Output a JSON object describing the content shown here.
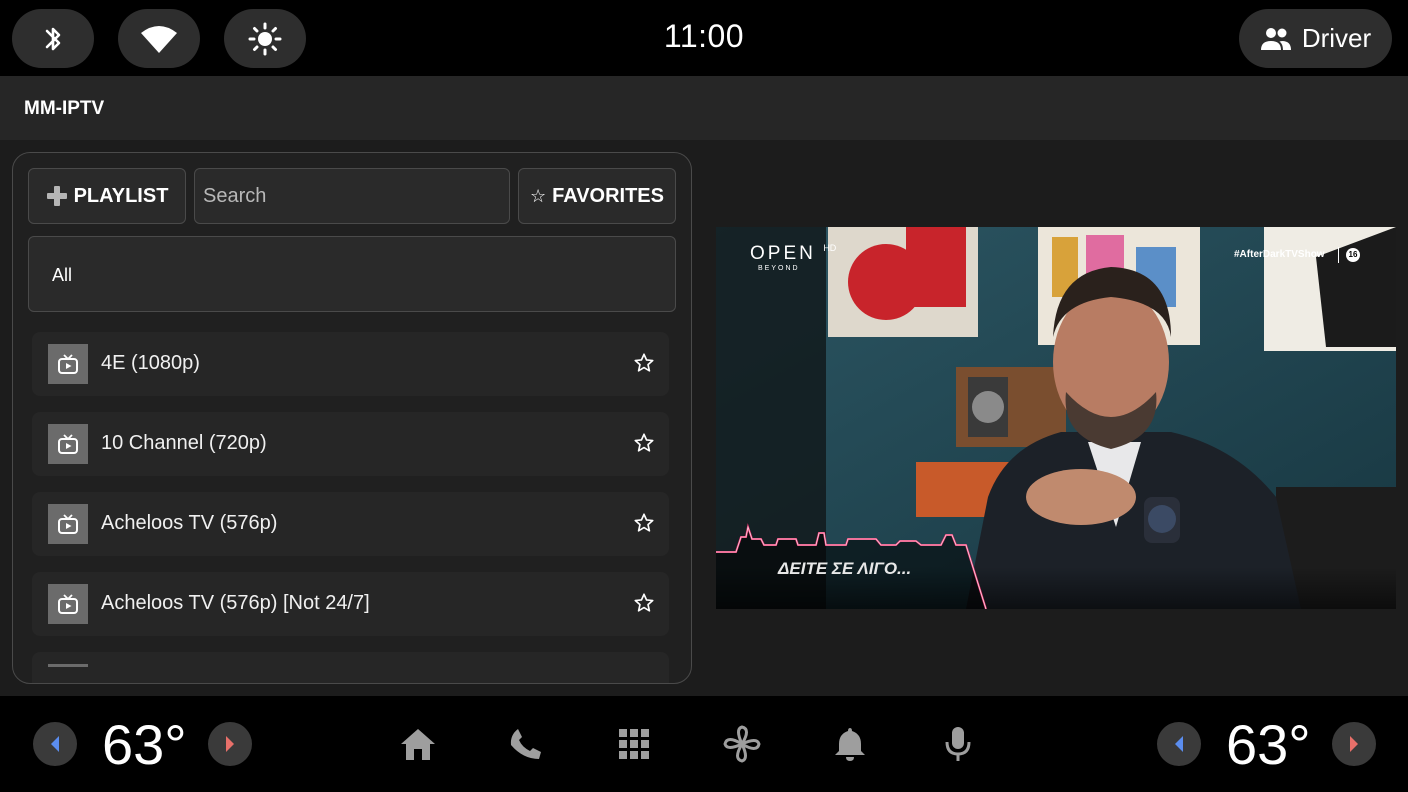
{
  "status": {
    "time": "11:00",
    "profile_label": "Driver"
  },
  "app": {
    "title": "MM-IPTV"
  },
  "toolbar": {
    "playlist_label": "PLAYLIST",
    "search_placeholder": "Search",
    "favorites_label": "FAVORITES"
  },
  "filter": {
    "selected": "All"
  },
  "channels": [
    {
      "name": "4E (1080p)"
    },
    {
      "name": "10 Channel (720p)"
    },
    {
      "name": "Acheloos TV (576p)"
    },
    {
      "name": "Acheloos TV (576p) [Not 24/7]"
    }
  ],
  "video": {
    "logo_text": "OPEN",
    "logo_sub": "BEYOND",
    "logo_hd": "HD",
    "hashtag": "#AfterDarkTVShow",
    "rating": "16",
    "caption": "ΔΕΙΤΕ ΣΕ ΛΙΓΟ..."
  },
  "climate": {
    "left_temp": "63°",
    "right_temp": "63°"
  },
  "colors": {
    "accent_blue": "#5b8def",
    "accent_red": "#e8706a"
  }
}
